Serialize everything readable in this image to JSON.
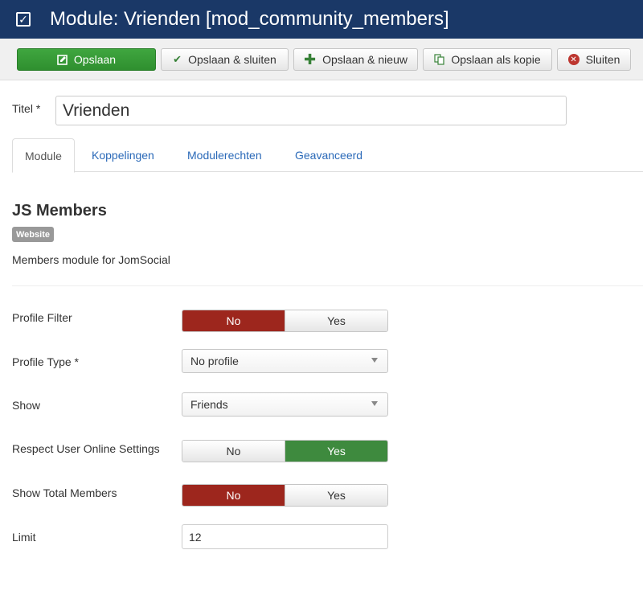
{
  "header": {
    "title": "Module: Vrienden [mod_community_members]",
    "icon": "checkbox-icon",
    "bg_color": "#1a3867"
  },
  "toolbar": {
    "save_label": "Opslaan",
    "save_close_label": "Opslaan & sluiten",
    "save_new_label": "Opslaan & nieuw",
    "save_copy_label": "Opslaan als kopie",
    "close_label": "Sluiten",
    "save_color": "#3fa63f"
  },
  "form": {
    "title_label": "Titel *",
    "title_value": "Vrienden"
  },
  "tabs": [
    {
      "label": "Module",
      "active": true
    },
    {
      "label": "Koppelingen",
      "active": false
    },
    {
      "label": "Modulerechten",
      "active": false
    },
    {
      "label": "Geavanceerd",
      "active": false
    }
  ],
  "module": {
    "name": "JS Members",
    "badge": "Website",
    "description": "Members module for JomSocial"
  },
  "fields": {
    "profile_filter": {
      "label": "Profile Filter",
      "no": "No",
      "yes": "Yes",
      "selected": "No"
    },
    "profile_type": {
      "label": "Profile Type *",
      "value": "No profile"
    },
    "show": {
      "label": "Show",
      "value": "Friends"
    },
    "respect_online": {
      "label": "Respect User Online Settings",
      "no": "No",
      "yes": "Yes",
      "selected": "Yes"
    },
    "show_total": {
      "label": "Show Total Members",
      "no": "No",
      "yes": "Yes",
      "selected": "No"
    },
    "limit": {
      "label": "Limit",
      "value": "12"
    }
  },
  "colors": {
    "toggle_no": "#9d261d",
    "toggle_yes": "#3e8a3e",
    "link": "#2a69b8"
  }
}
